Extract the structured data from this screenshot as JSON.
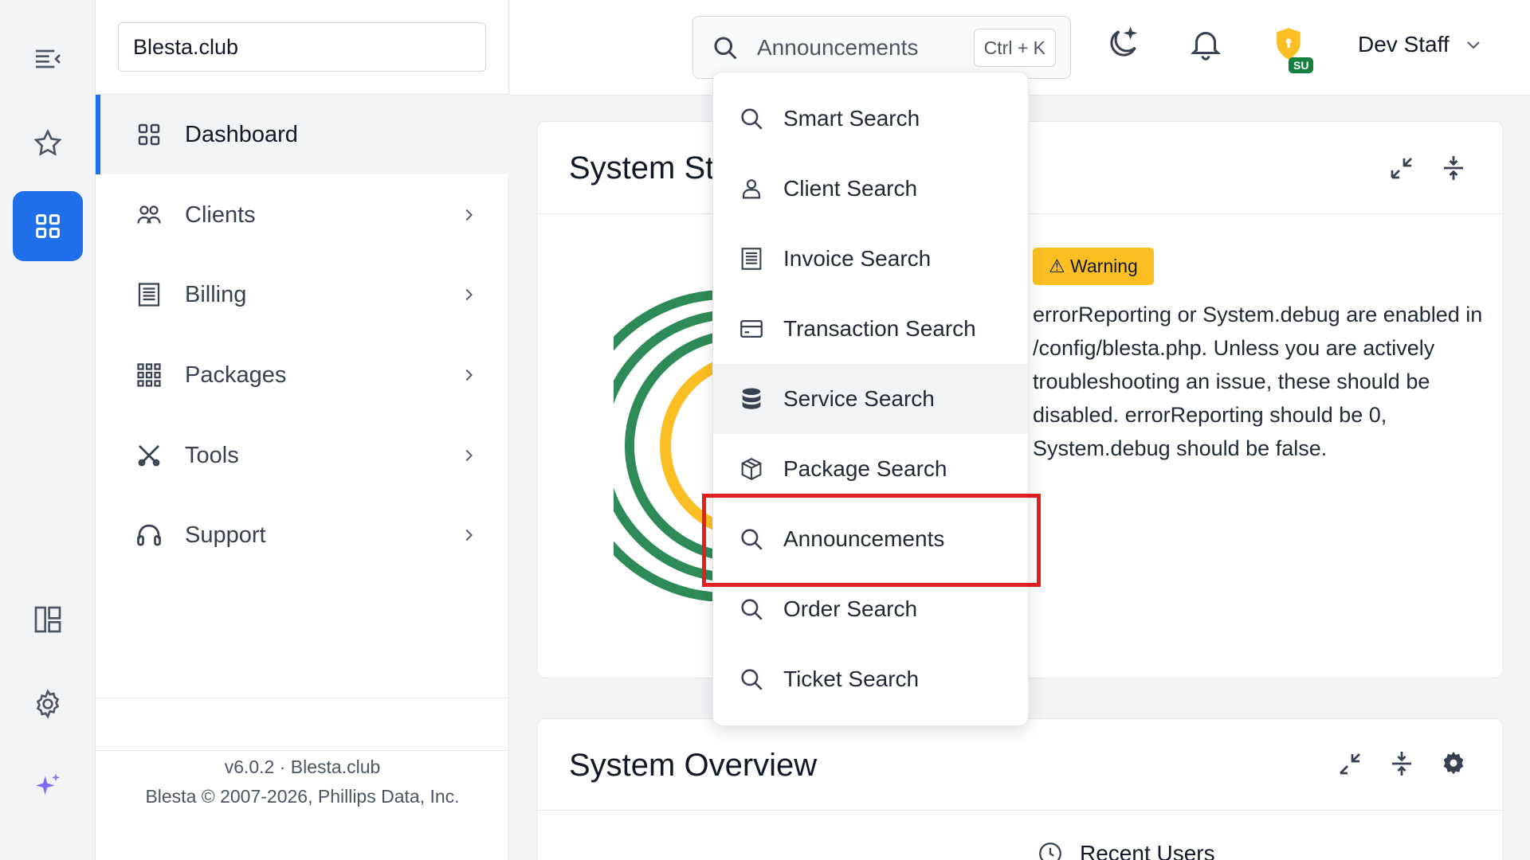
{
  "site": {
    "name": "Blesta.club"
  },
  "rail": {
    "items": [
      {
        "icon": "menu-collapse-icon"
      },
      {
        "icon": "star-icon"
      },
      {
        "icon": "grid-icon",
        "active": true
      },
      {
        "icon": "layout-icon"
      },
      {
        "icon": "gear-icon"
      },
      {
        "icon": "sparkle-icon"
      }
    ]
  },
  "sidebar": {
    "items": [
      {
        "label": "Dashboard",
        "icon": "grid-icon",
        "active": true
      },
      {
        "label": "Clients",
        "icon": "users-icon"
      },
      {
        "label": "Billing",
        "icon": "invoice-icon"
      },
      {
        "label": "Packages",
        "icon": "dots-grid-icon"
      },
      {
        "label": "Tools",
        "icon": "tools-icon"
      },
      {
        "label": "Support",
        "icon": "headset-icon"
      }
    ]
  },
  "footer": {
    "version": "v6.0.2 · Blesta.club",
    "copyright": "Blesta © 2007-2026, Phillips Data, Inc."
  },
  "header": {
    "search": {
      "value": "Announcements",
      "shortcut": "Ctrl + K"
    },
    "user": {
      "name": "Dev Staff",
      "badge": "SU"
    },
    "icons": [
      "moon-icon",
      "bell-icon",
      "shield-icon"
    ]
  },
  "dropdown": {
    "items": [
      {
        "label": "Smart Search",
        "icon": "search-icon"
      },
      {
        "label": "Client Search",
        "icon": "user-icon"
      },
      {
        "label": "Invoice Search",
        "icon": "invoice-icon"
      },
      {
        "label": "Transaction Search",
        "icon": "card-icon"
      },
      {
        "label": "Service Search",
        "icon": "database-icon",
        "hover": true
      },
      {
        "label": "Package Search",
        "icon": "box-icon"
      },
      {
        "label": "Announcements",
        "icon": "search-icon",
        "highlighted": true
      },
      {
        "label": "Order Search",
        "icon": "search-icon"
      },
      {
        "label": "Ticket Search",
        "icon": "search-icon"
      }
    ]
  },
  "system_status": {
    "title": "System St",
    "warning_badge": "⚠ Warning",
    "warning_text": "errorReporting or System.debug are enabled in /config/blesta.php. Unless you are actively troubleshooting an issue, these should be disabled. errorReporting should be 0, System.debug should be false."
  },
  "system_overview": {
    "title": "System Overview",
    "recent_users": "Recent Users"
  },
  "colors": {
    "accent": "#1f6feb",
    "warning": "#fbbf24",
    "ring_green": "#2e8b57",
    "ring_yellow": "#fbbf24",
    "highlight": "#e0201f",
    "badge_green": "#15803d"
  }
}
